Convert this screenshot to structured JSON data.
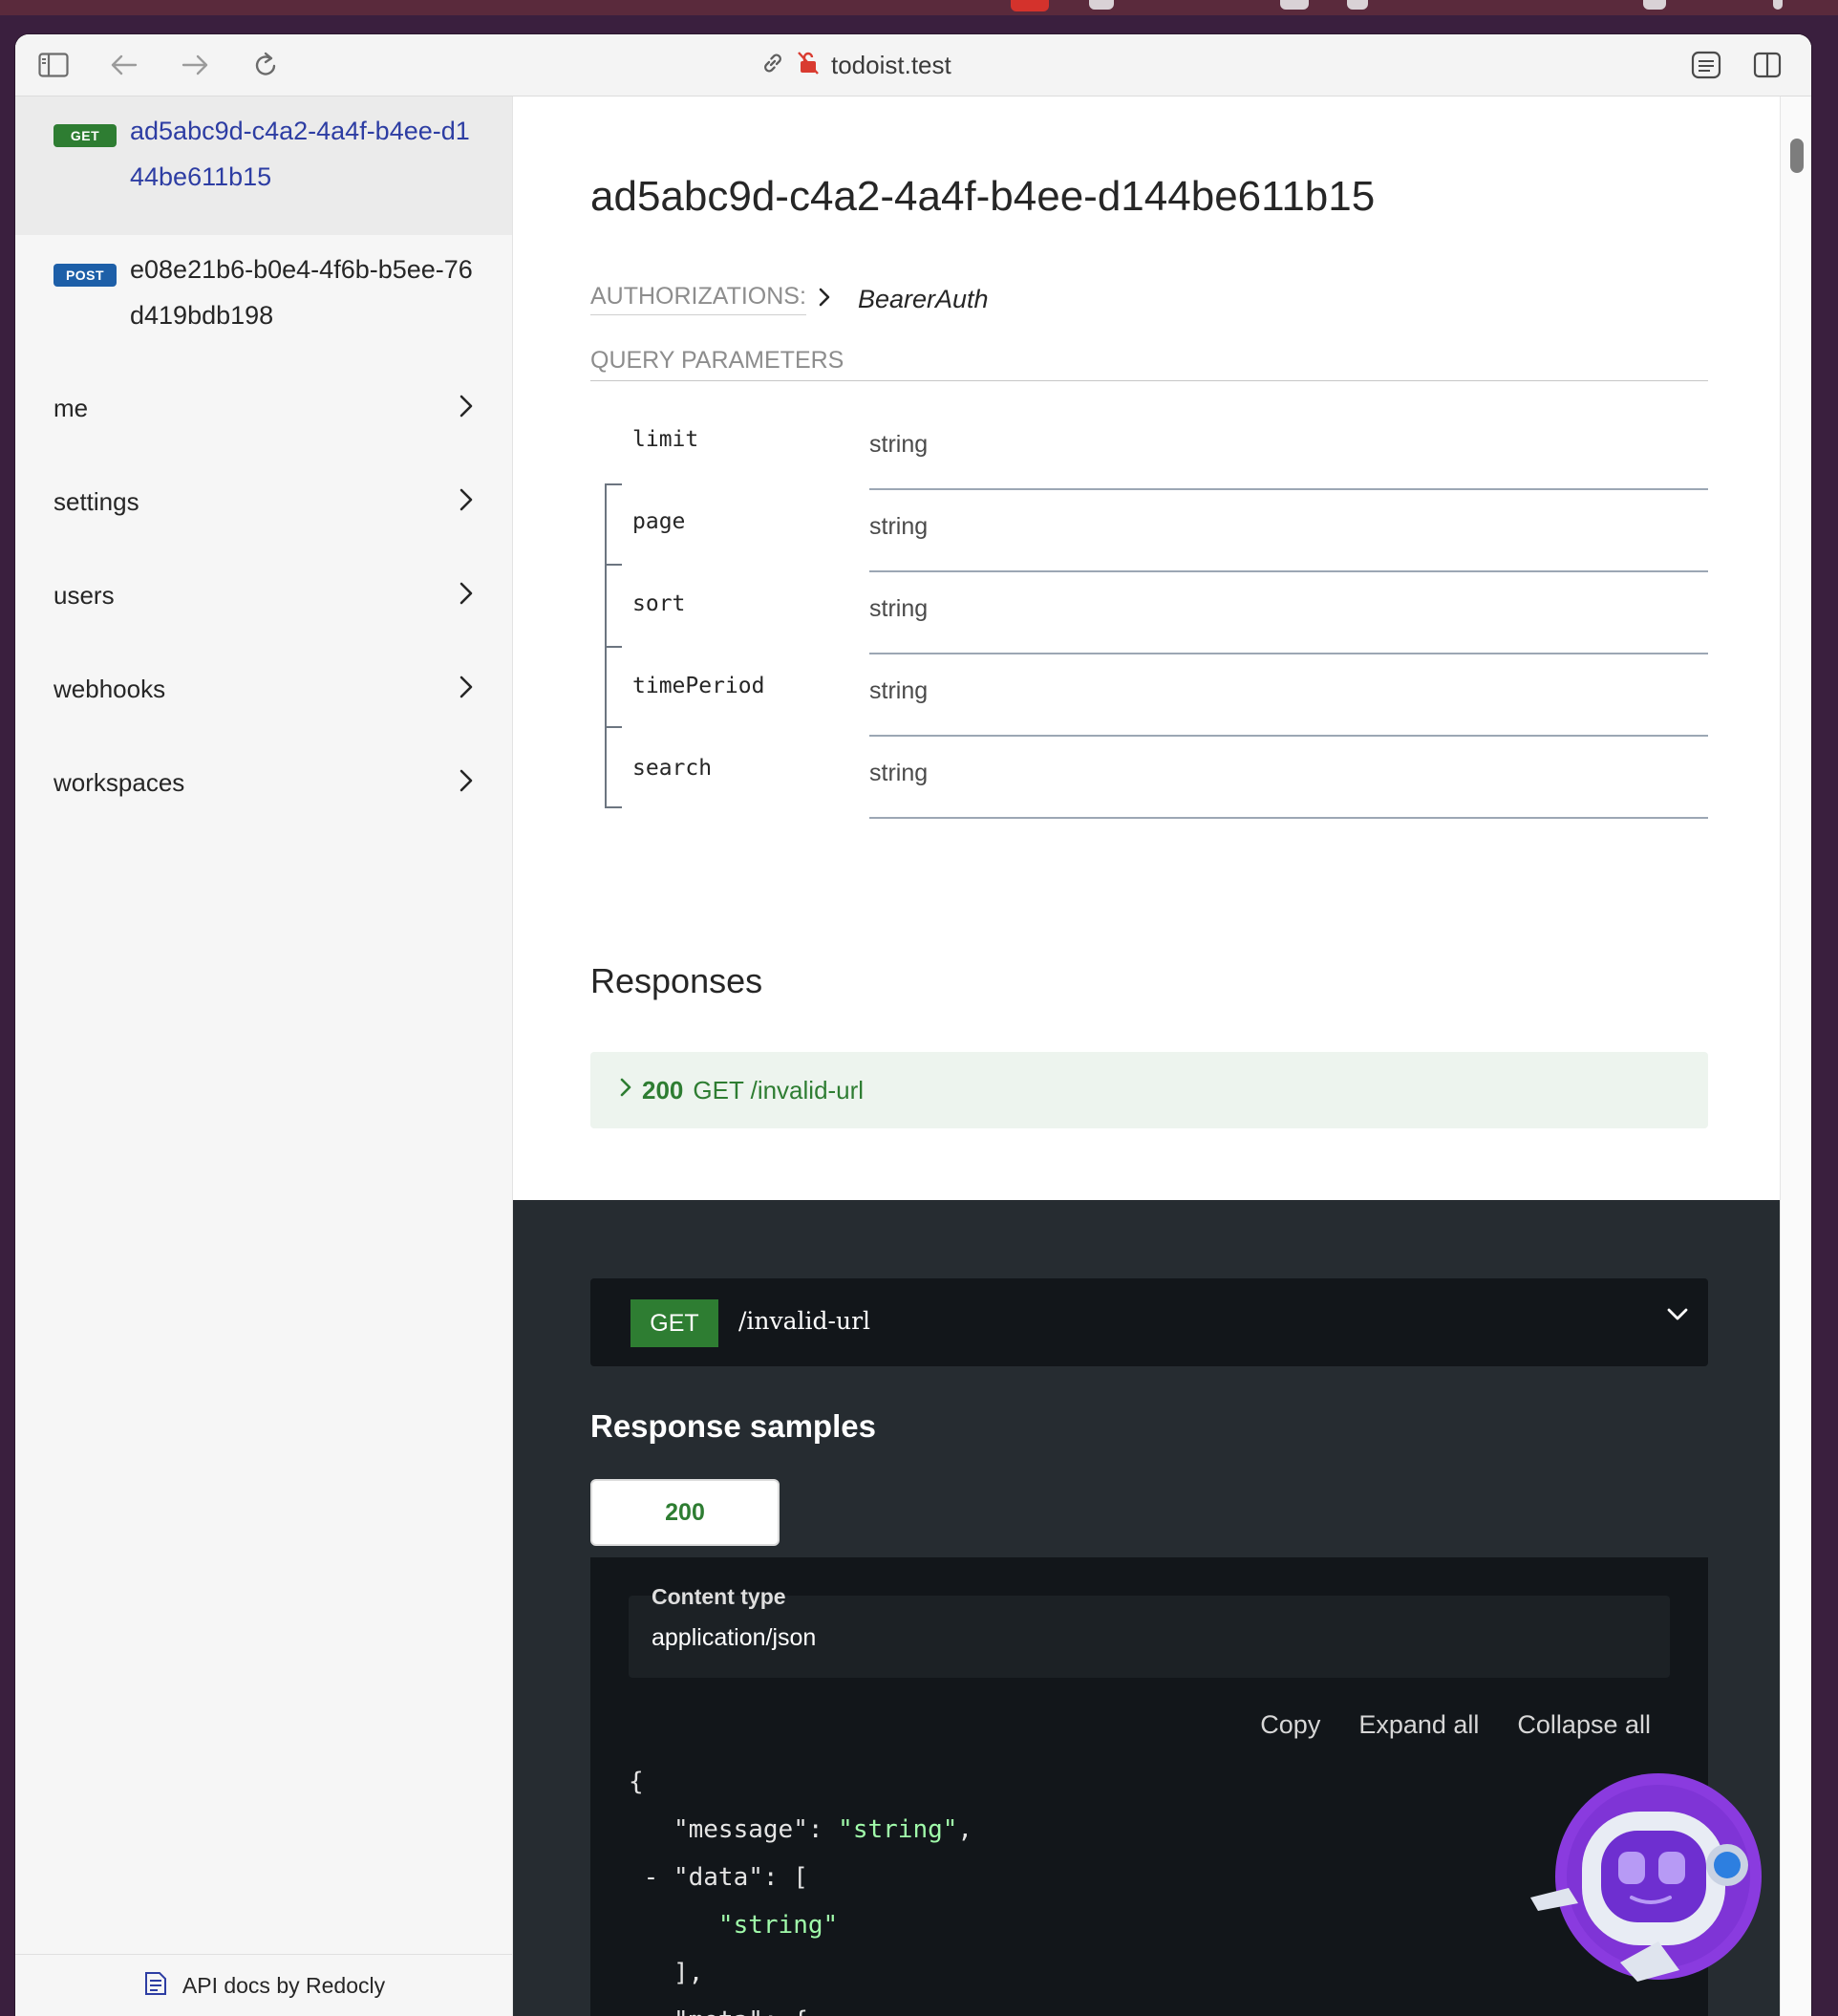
{
  "browser": {
    "url": "todoist.test",
    "icons": [
      "sidebar-toggle-icon",
      "back-arrow-icon",
      "forward-arrow-icon",
      "reload-icon",
      "link-icon",
      "insecure-lock-icon",
      "reader-icon",
      "split-view-icon"
    ]
  },
  "sidebar": {
    "operations": [
      {
        "method": "GET",
        "label": "ad5abc9d-c4a2-4a4f-b4ee-d144be611b15",
        "active": true
      },
      {
        "method": "POST",
        "label": "e08e21b6-b0e4-4f6b-b5ee-76d419bdb198",
        "active": false
      }
    ],
    "groups": [
      "me",
      "settings",
      "users",
      "webhooks",
      "workspaces"
    ],
    "footer": "API docs by Redocly"
  },
  "main": {
    "title": "ad5abc9d-c4a2-4a4f-b4ee-d144be611b15",
    "authorizations_label": "AUTHORIZATIONS:",
    "authorizations_value": "BearerAuth",
    "query_parameters_label": "QUERY PARAMETERS",
    "parameters": [
      {
        "name": "limit",
        "type": "string"
      },
      {
        "name": "page",
        "type": "string"
      },
      {
        "name": "sort",
        "type": "string"
      },
      {
        "name": "timePeriod",
        "type": "string"
      },
      {
        "name": "search",
        "type": "string"
      }
    ],
    "responses_title": "Responses",
    "response": {
      "code": "200",
      "text": "GET /invalid-url"
    }
  },
  "samples": {
    "endpoint_method": "GET",
    "endpoint_path": "/invalid-url",
    "title": "Response samples",
    "tab": "200",
    "content_type_label": "Content type",
    "content_type_value": "application/json",
    "actions": [
      "Copy",
      "Expand all",
      "Collapse all"
    ],
    "code": {
      "open_brace": "{",
      "message_key": "\"message\"",
      "message_value": "\"string\"",
      "data_key": "\"data\"",
      "data_item": "\"string\"",
      "data_close": "],",
      "meta_key": "\"meta\""
    }
  },
  "colors": {
    "get": "#2e7d32",
    "post": "#1d5fa8",
    "dark_panel": "#262c31",
    "code_string": "#a0fbaa"
  }
}
